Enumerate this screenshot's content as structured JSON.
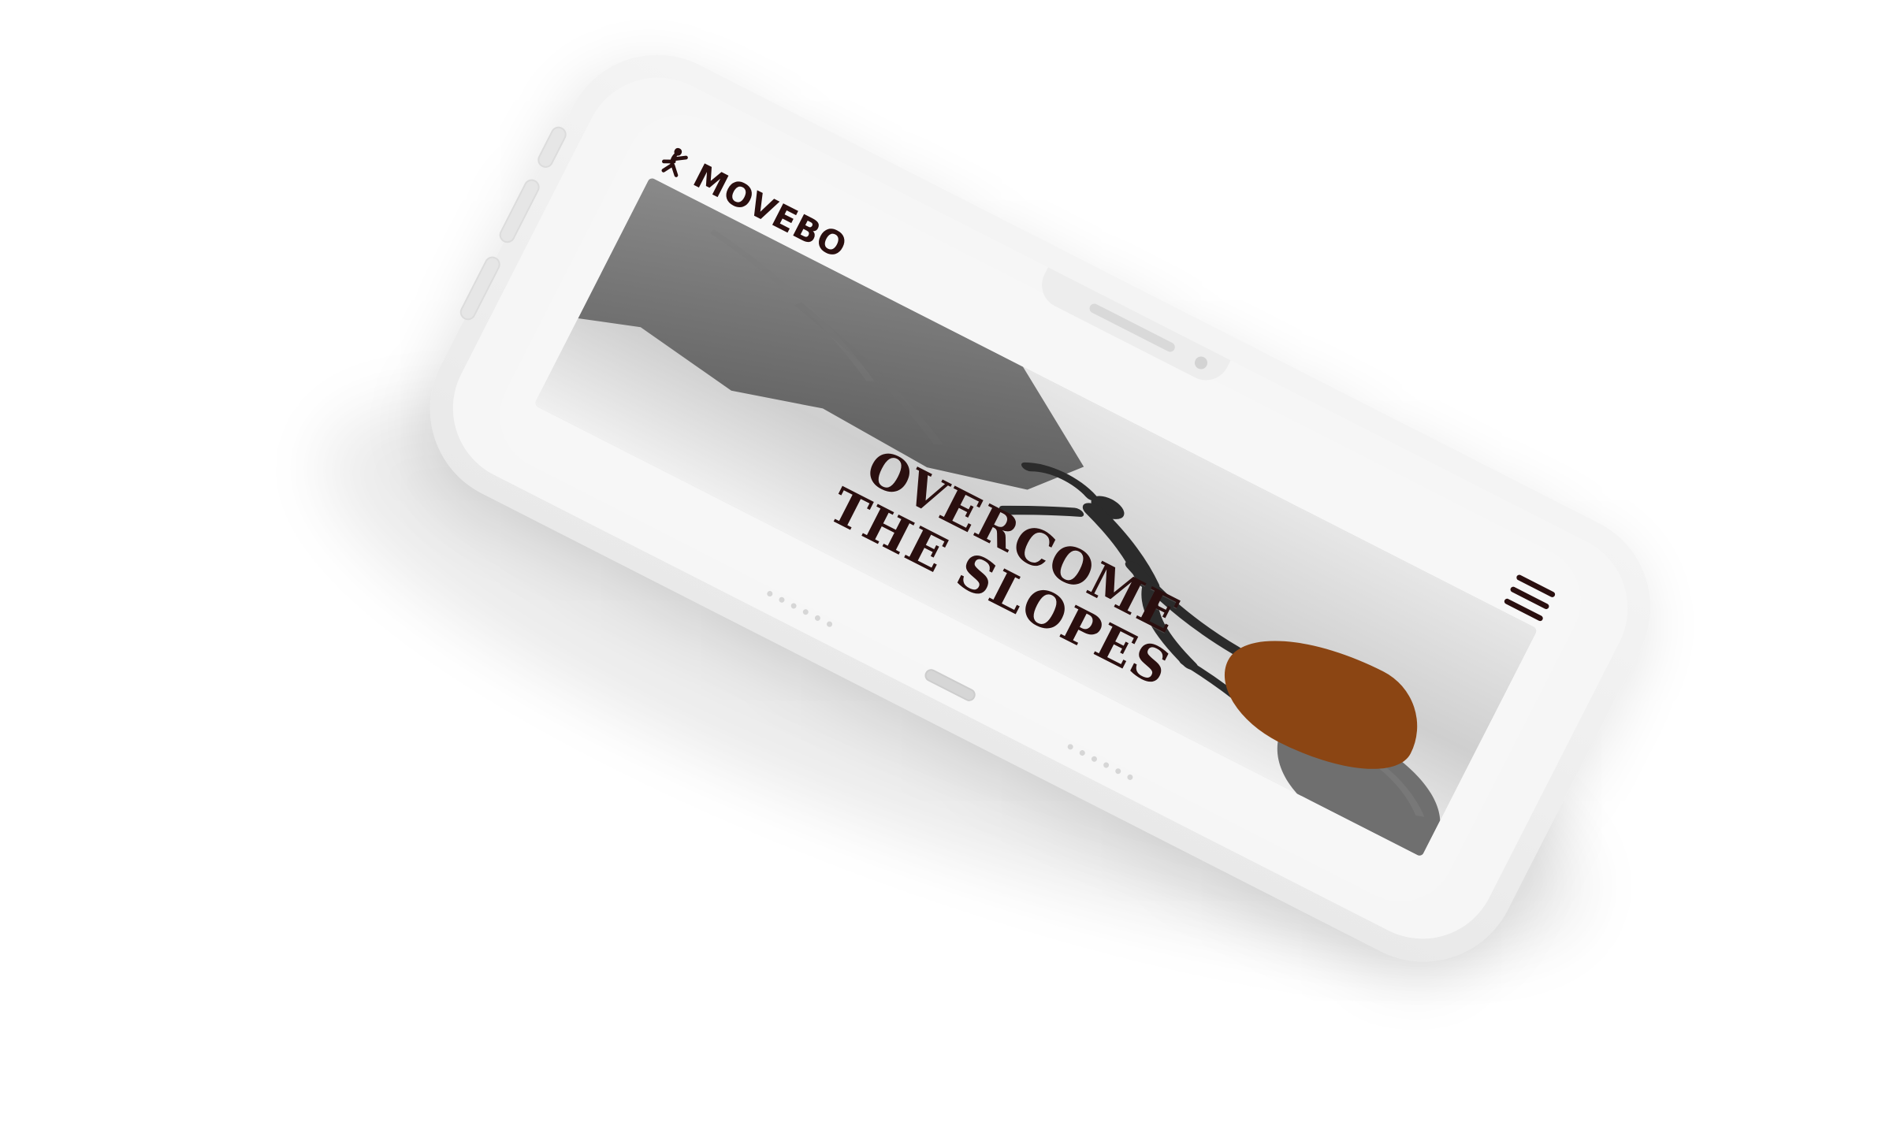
{
  "brand": {
    "name": "MOVEBO",
    "logo_icon": "climber-mark-icon"
  },
  "header": {
    "menu_icon": "menu-icon"
  },
  "hero": {
    "headline_line1": "OVERCOME",
    "headline_line2": "THE SLOPES"
  },
  "colors": {
    "accent": "#8B4513",
    "brand_dark": "#2A0F0F"
  }
}
